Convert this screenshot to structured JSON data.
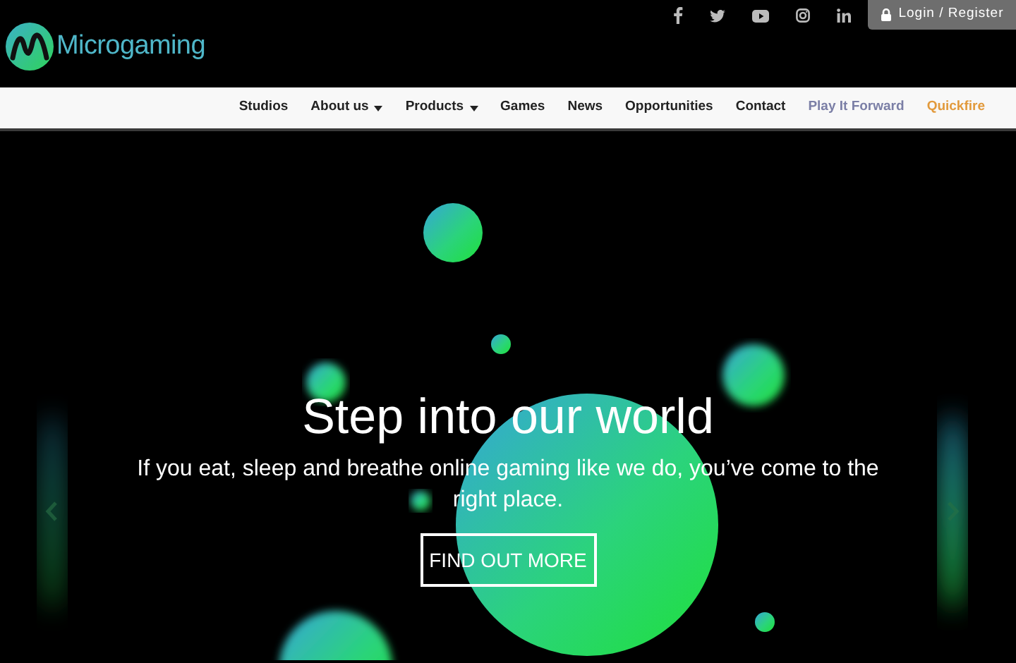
{
  "header": {
    "logo_text": "Microgaming",
    "login_button": "Login / Register"
  },
  "nav": {
    "items": [
      {
        "label": "Studios",
        "has_menu": false,
        "color": "#222222"
      },
      {
        "label": "About us",
        "has_menu": true,
        "color": "#222222"
      },
      {
        "label": "Products",
        "has_menu": true,
        "color": "#222222"
      },
      {
        "label": "Games",
        "has_menu": false,
        "color": "#222222"
      },
      {
        "label": "News",
        "has_menu": false,
        "color": "#222222"
      },
      {
        "label": "Opportunities",
        "has_menu": false,
        "color": "#222222"
      },
      {
        "label": "Contact",
        "has_menu": false,
        "color": "#222222"
      },
      {
        "label": "Play It Forward",
        "has_menu": false,
        "color": "#7b7fa6"
      },
      {
        "label": "Quickfire",
        "has_menu": false,
        "color": "#e29a3c"
      }
    ]
  },
  "hero": {
    "title": "Step into our world",
    "subtitle": "If you eat, sleep and breathe online gaming like we do, you’ve come to the right place.",
    "button": "FIND OUT MORE"
  }
}
